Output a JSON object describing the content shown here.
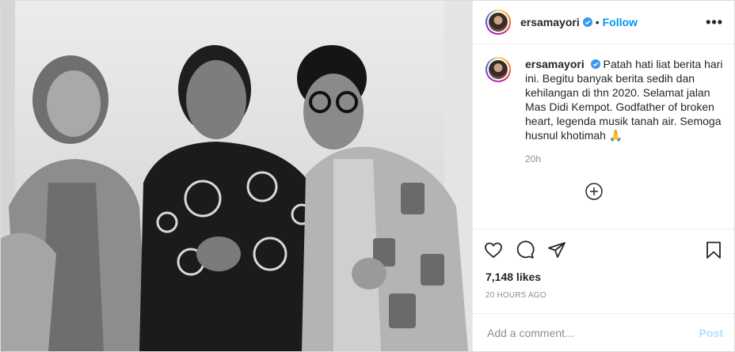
{
  "post": {
    "username": "ersamayori",
    "follow_label": "Follow",
    "separator": "•",
    "more_label": "•••",
    "caption": {
      "username": "ersamayori",
      "text": "Patah hati liat berita hari ini. Begitu banyak berita sedih dan kehilangan di thn 2020. Selamat jalan Mas Didi Kempot. Godfather of broken heart, legenda musik tanah air. Semoga husnul khotimah 🙏",
      "time": "20h"
    },
    "likes": "7,148 likes",
    "posted_ago": "20 HOURS AGO",
    "add_comment_placeholder": "Add a comment...",
    "post_label": "Post"
  },
  "icons": {
    "verified": "verified-badge-icon",
    "load_more": "plus-circle-icon",
    "like": "heart-icon",
    "comment": "comment-bubble-icon",
    "share": "paper-plane-icon",
    "save": "bookmark-icon"
  },
  "colors": {
    "accent": "#0095f6",
    "post_disabled": "#b2dffc",
    "muted": "#8e8e8e",
    "text": "#262626"
  }
}
